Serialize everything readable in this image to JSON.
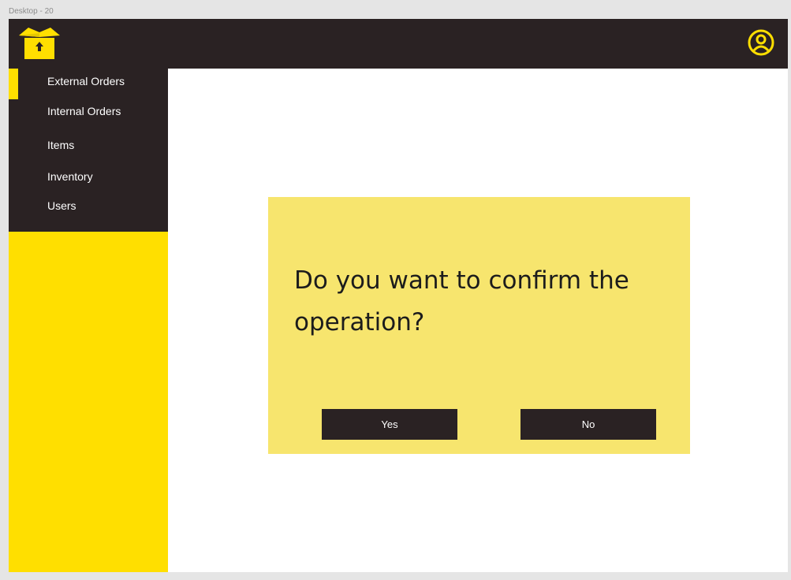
{
  "frame": {
    "label": "Desktop - 20"
  },
  "header": {
    "logo_icon": "box-logo-icon",
    "user_icon": "user-circle-icon"
  },
  "sidebar": {
    "items": [
      {
        "label": "External Orders",
        "active": true
      },
      {
        "label": "Internal Orders",
        "active": false
      },
      {
        "label": "Items",
        "active": false
      },
      {
        "label": "Inventory",
        "active": false
      },
      {
        "label": "Users",
        "active": false
      }
    ]
  },
  "dialog": {
    "message": "Do you want to confirm the operation?",
    "yes_label": "Yes",
    "no_label": "No"
  },
  "colors": {
    "dark": "#2a2223",
    "accent": "#ffdf00",
    "dialog_bg": "#f7e56e",
    "page_bg": "#ffffff"
  }
}
